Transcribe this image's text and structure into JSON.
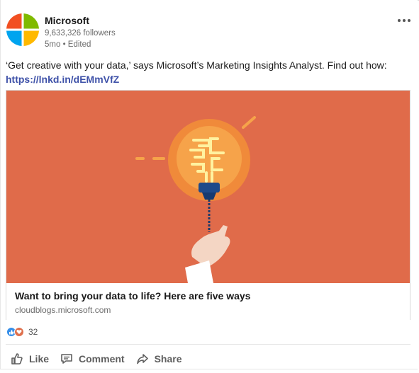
{
  "post": {
    "author": "Microsoft",
    "followers": "9,633,326 followers",
    "meta": "5mo • Edited",
    "text": "‘Get creative with your data,’ says Microsoft’s Marketing Insights Analyst. Find out how:",
    "link": "https://lnkd.in/dEMmVfZ"
  },
  "preview": {
    "title": "Want to bring your data to life? Here are five ways",
    "domain": "cloudblogs.microsoft.com",
    "bg_color": "#e06b4a"
  },
  "reactions": {
    "count": "32",
    "types": [
      "like-icon",
      "love-icon"
    ]
  },
  "actions": {
    "like": "Like",
    "comment": "Comment",
    "share": "Share"
  },
  "colors": {
    "logo_red": "#f25022",
    "logo_green": "#7fba00",
    "logo_blue": "#00a4ef",
    "logo_yellow": "#ffb900",
    "link": "#3e51a8"
  }
}
